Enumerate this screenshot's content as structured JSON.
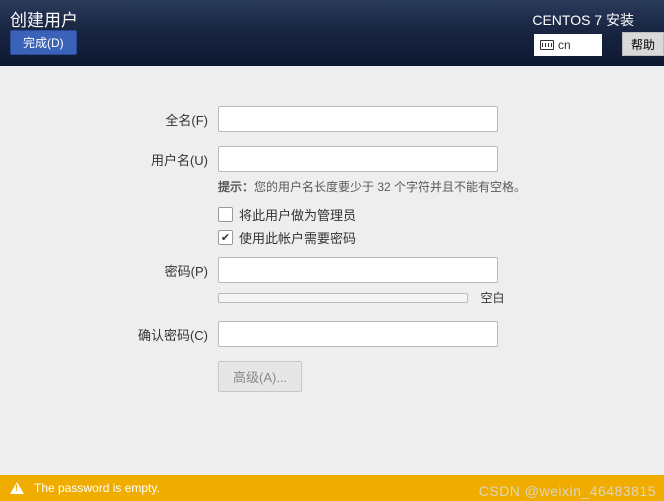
{
  "header": {
    "title": "创建用户",
    "done_label": "完成(D)",
    "install_title": "CENTOS 7 安装",
    "lang_code": "cn",
    "help_label": "帮助"
  },
  "form": {
    "fullname_label": "全名(F)",
    "fullname_value": "",
    "username_label": "用户名(U)",
    "username_value": "",
    "hint_prefix": "提示：",
    "hint_text": "您的用户名长度要少于 32 个字符并且不能有空格。",
    "admin_checkbox_label": "将此用户做为管理员",
    "admin_checked": false,
    "require_pwd_label": "使用此帐户需要密码",
    "require_pwd_checked": true,
    "password_label": "密码(P)",
    "password_value": "",
    "strength_label": "空白",
    "confirm_label": "确认密码(C)",
    "confirm_value": "",
    "advanced_label": "高级(A)..."
  },
  "warning": {
    "text": "The password is empty."
  },
  "watermark": "CSDN @weixin_46483815"
}
